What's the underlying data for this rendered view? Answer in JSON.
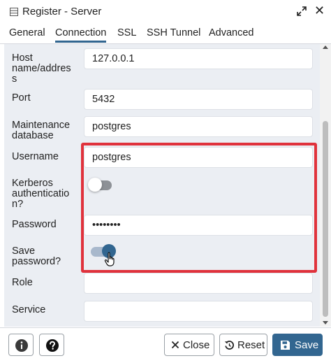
{
  "window": {
    "title": "Register - Server",
    "icons": {
      "app": "server-icon",
      "expand": "expand-icon",
      "close": "close-icon"
    },
    "close_glyph": "✕"
  },
  "tabs": [
    "General",
    "Connection",
    "SSL",
    "SSH Tunnel",
    "Advanced"
  ],
  "active_tab": "Connection",
  "form": {
    "host_label": [
      "Host",
      "name/addres",
      "s"
    ],
    "host_value": "127.0.0.1",
    "port_label": "Port",
    "port_value": "5432",
    "maintenance_label": [
      "Maintenance",
      "database"
    ],
    "maintenance_value": "postgres",
    "username_label": "Username",
    "username_value": "postgres",
    "kerberos_label": [
      "Kerberos",
      "authenticatio",
      "n?"
    ],
    "kerberos_enabled": false,
    "password_label": "Password",
    "password_value": "••••••••",
    "save_password_label": [
      "Save",
      "password?"
    ],
    "save_password_enabled": true,
    "role_label": "Role",
    "role_value": "",
    "service_label": "Service",
    "service_value": ""
  },
  "footer": {
    "info_icon": "info-icon",
    "help_icon": "help-icon",
    "close_label": "Close",
    "reset_label": "Reset",
    "save_label": "Save"
  },
  "colors": {
    "accent": "#326690",
    "highlight": "#e0323c",
    "panel_bg": "#ebeef3"
  }
}
